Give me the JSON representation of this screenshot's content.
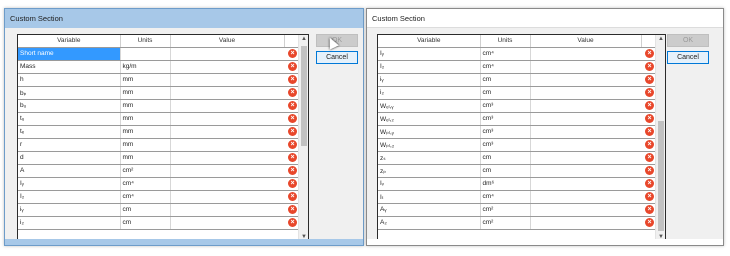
{
  "left_dialog": {
    "title": "Custom Section",
    "columns": [
      "Variable",
      "Units",
      "Value"
    ],
    "rows": [
      {
        "variable": "Short name",
        "units": "",
        "value": ""
      },
      {
        "variable": "Mass",
        "units": "kg/m",
        "value": ""
      },
      {
        "variable": "h",
        "units": "mm",
        "value": ""
      },
      {
        "variable": "bₚ",
        "units": "mm",
        "value": ""
      },
      {
        "variable": "bᵤ",
        "units": "mm",
        "value": ""
      },
      {
        "variable": "tᵤ",
        "units": "mm",
        "value": ""
      },
      {
        "variable": "tₑ",
        "units": "mm",
        "value": ""
      },
      {
        "variable": "r",
        "units": "mm",
        "value": ""
      },
      {
        "variable": "d",
        "units": "mm",
        "value": ""
      },
      {
        "variable": "A",
        "units": "cm²",
        "value": ""
      },
      {
        "variable": "Iᵧ",
        "units": "cm⁴",
        "value": ""
      },
      {
        "variable": "I₂",
        "units": "cm⁴",
        "value": ""
      },
      {
        "variable": "iᵧ",
        "units": "cm",
        "value": ""
      },
      {
        "variable": "i₂",
        "units": "cm",
        "value": ""
      }
    ],
    "buttons": {
      "ok": "OK",
      "cancel": "Cancel"
    }
  },
  "right_dialog": {
    "title": "Custom Section",
    "columns": [
      "Variable",
      "Units",
      "Value"
    ],
    "rows": [
      {
        "variable": "Iᵧ",
        "units": "cm⁴",
        "value": ""
      },
      {
        "variable": "I₂",
        "units": "cm⁴",
        "value": ""
      },
      {
        "variable": "iᵧ",
        "units": "cm",
        "value": ""
      },
      {
        "variable": "i₂",
        "units": "cm",
        "value": ""
      },
      {
        "variable": "Wₑₗ,ᵧ",
        "units": "cm³",
        "value": ""
      },
      {
        "variable": "Wₑₗ,₂",
        "units": "cm³",
        "value": ""
      },
      {
        "variable": "Wₚₗ,ᵧ",
        "units": "cm³",
        "value": ""
      },
      {
        "variable": "Wₚₗ,₂",
        "units": "cm³",
        "value": ""
      },
      {
        "variable": "zₛ",
        "units": "cm",
        "value": ""
      },
      {
        "variable": "zₚ",
        "units": "cm",
        "value": ""
      },
      {
        "variable": "Iᵥ",
        "units": "dm⁶",
        "value": ""
      },
      {
        "variable": "Iₜ",
        "units": "cm⁴",
        "value": ""
      },
      {
        "variable": "Aᵧ",
        "units": "cm²",
        "value": ""
      },
      {
        "variable": "A₂",
        "units": "cm²",
        "value": ""
      }
    ],
    "buttons": {
      "ok": "OK",
      "cancel": "Cancel"
    }
  },
  "delete_icon_glyph": "×",
  "scroll_up_glyph": "▲",
  "scroll_down_glyph": "▼",
  "colors": {
    "accent": "#0078d7",
    "selection": "#3399ff",
    "delete": "#e8472b",
    "active_frame": "#a7c8e8"
  },
  "icons": [
    "delete-row-icon",
    "scroll-up-arrow-icon",
    "scroll-down-arrow-icon",
    "mouse-cursor-icon"
  ]
}
